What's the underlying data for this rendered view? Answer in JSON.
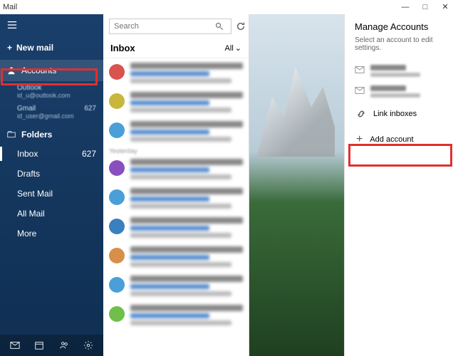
{
  "title": "Mail",
  "window_controls": {
    "min": "—",
    "max": "□",
    "close": "✕"
  },
  "sidebar": {
    "new_mail": "New mail",
    "accounts_label": "Accounts",
    "accounts": [
      {
        "name": "Outlook",
        "email": "id_u@outlook.com"
      },
      {
        "name": "Gmail",
        "email": "id_user@gmail.com",
        "count": "627"
      }
    ],
    "folders_label": "Folders",
    "folders": [
      {
        "label": "Inbox",
        "count": "627",
        "active": true
      },
      {
        "label": "Drafts"
      },
      {
        "label": "Sent Mail"
      },
      {
        "label": "All Mail"
      },
      {
        "label": "More"
      }
    ]
  },
  "search": {
    "placeholder": "Search"
  },
  "list": {
    "header": "Inbox",
    "filter": "All",
    "items": [
      {
        "color": "#d9534f"
      },
      {
        "color": "#c9b63c"
      },
      {
        "color": "#4a9fd8"
      },
      {
        "color": "#8a4fbf"
      },
      {
        "color": "#4a9fd8"
      },
      {
        "color": "#3a7fbf"
      },
      {
        "color": "#d88f4a"
      },
      {
        "color": "#4a9fd8"
      },
      {
        "color": "#6fbf4a"
      }
    ]
  },
  "panel": {
    "title": "Manage Accounts",
    "hint": "Select an account to edit settings.",
    "accounts": [
      {
        "n": "Outlook"
      },
      {
        "n": "Gmail"
      }
    ],
    "link_inboxes": "Link inboxes",
    "add_account": "Add account"
  }
}
